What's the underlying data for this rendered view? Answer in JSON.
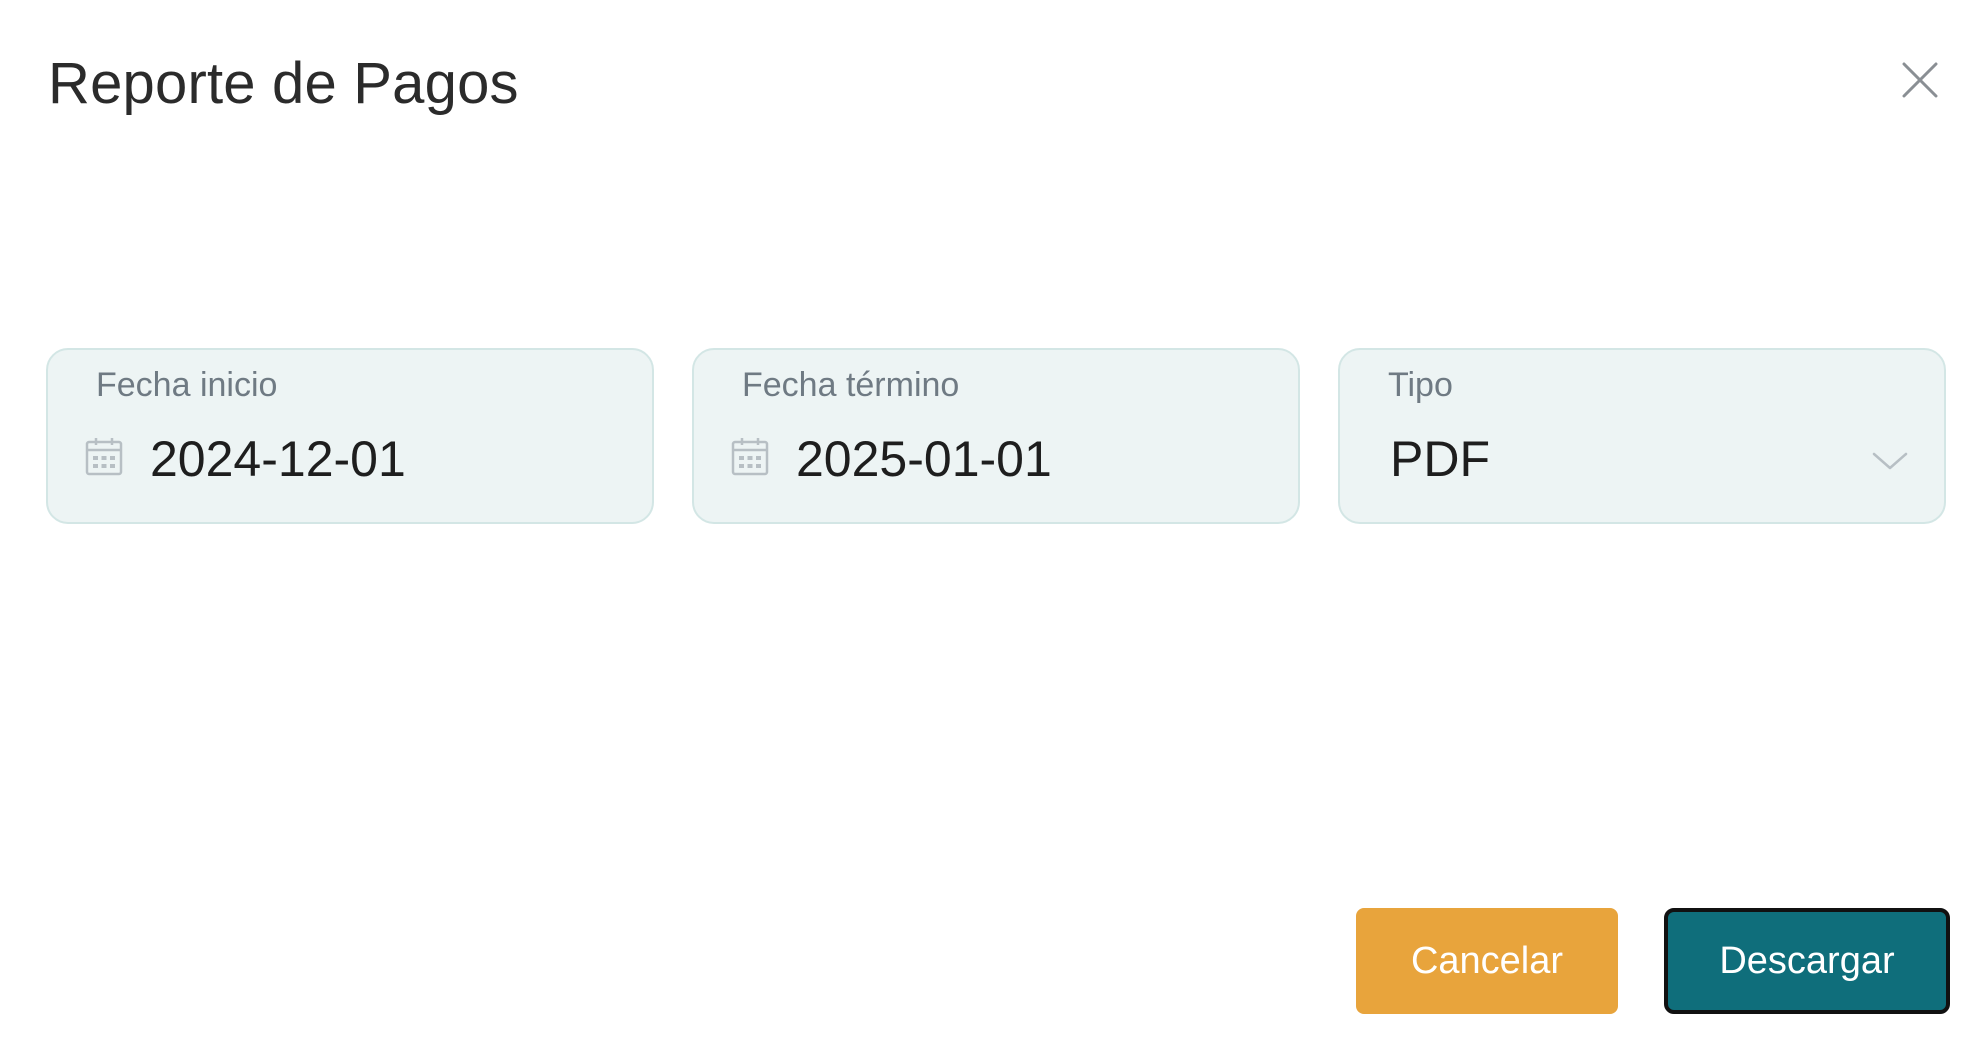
{
  "dialog": {
    "title": "Reporte de Pagos",
    "close_icon": "close-icon"
  },
  "fields": {
    "start_date": {
      "label": "Fecha inicio",
      "value": "2024-12-01",
      "icon": "calendar-icon"
    },
    "end_date": {
      "label": "Fecha término",
      "value": "2025-01-01",
      "icon": "calendar-icon"
    },
    "type": {
      "label": "Tipo",
      "value": "PDF",
      "icon": "chevron-down-icon"
    }
  },
  "actions": {
    "cancel_label": "Cancelar",
    "download_label": "Descargar"
  },
  "colors": {
    "field_background": "#edf4f4",
    "field_border": "#d3e6e5",
    "cancel_button": "#e8a43c",
    "download_button": "#0f6e7b"
  }
}
